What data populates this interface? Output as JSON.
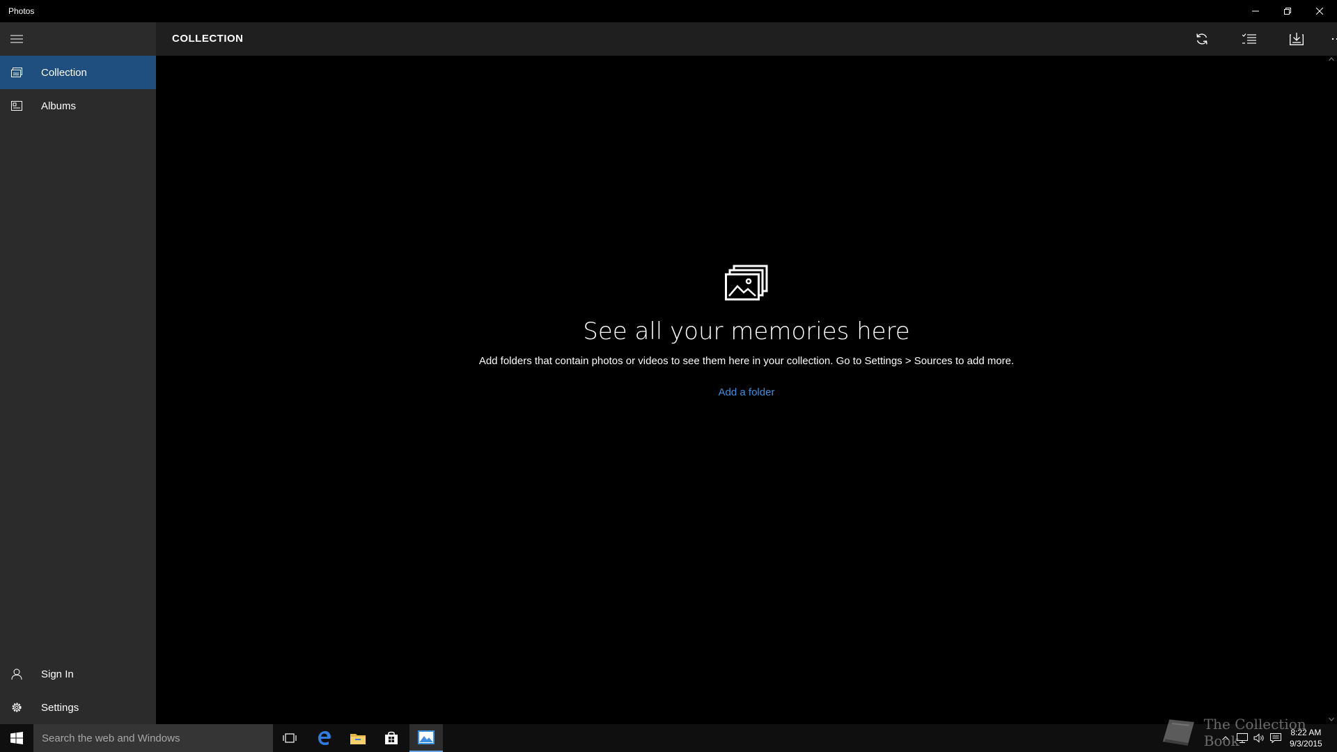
{
  "window": {
    "app_title": "Photos",
    "controls": [
      "minimize-icon",
      "restore-icon",
      "close-icon"
    ]
  },
  "sidebar": {
    "menu_icon": "hamburger-icon",
    "items": [
      {
        "label": "Collection",
        "icon": "collection-icon",
        "selected": true
      },
      {
        "label": "Albums",
        "icon": "album-icon",
        "selected": false
      }
    ],
    "footer_items": [
      {
        "label": "Sign In",
        "icon": "person-icon"
      },
      {
        "label": "Settings",
        "icon": "gear-icon"
      }
    ]
  },
  "header": {
    "title": "COLLECTION",
    "commands": [
      "refresh-icon",
      "select-icon",
      "import-icon",
      "more-icon"
    ]
  },
  "empty_state": {
    "icon": "photos-icon",
    "heading": "See all your memories here",
    "description": "Add folders that contain photos or videos to see them here in your collection. Go to Settings > Sources to add more.",
    "action_label": "Add a folder"
  },
  "taskbar": {
    "search_placeholder": "Search the web and Windows",
    "pinned": [
      "task-view-icon",
      "edge-icon",
      "file-explorer-icon",
      "store-icon",
      "photos-app-icon"
    ],
    "active_app": "photos-app-icon",
    "time": "8:22 AM",
    "date": "9/3/2015"
  },
  "watermark": {
    "text": "The Collection Book"
  },
  "colors": {
    "accent": "#1f4f7e",
    "link": "#3b8ee0",
    "sidebar_bg": "#2b2b2b",
    "command_bar_bg": "#1f1f1f"
  }
}
